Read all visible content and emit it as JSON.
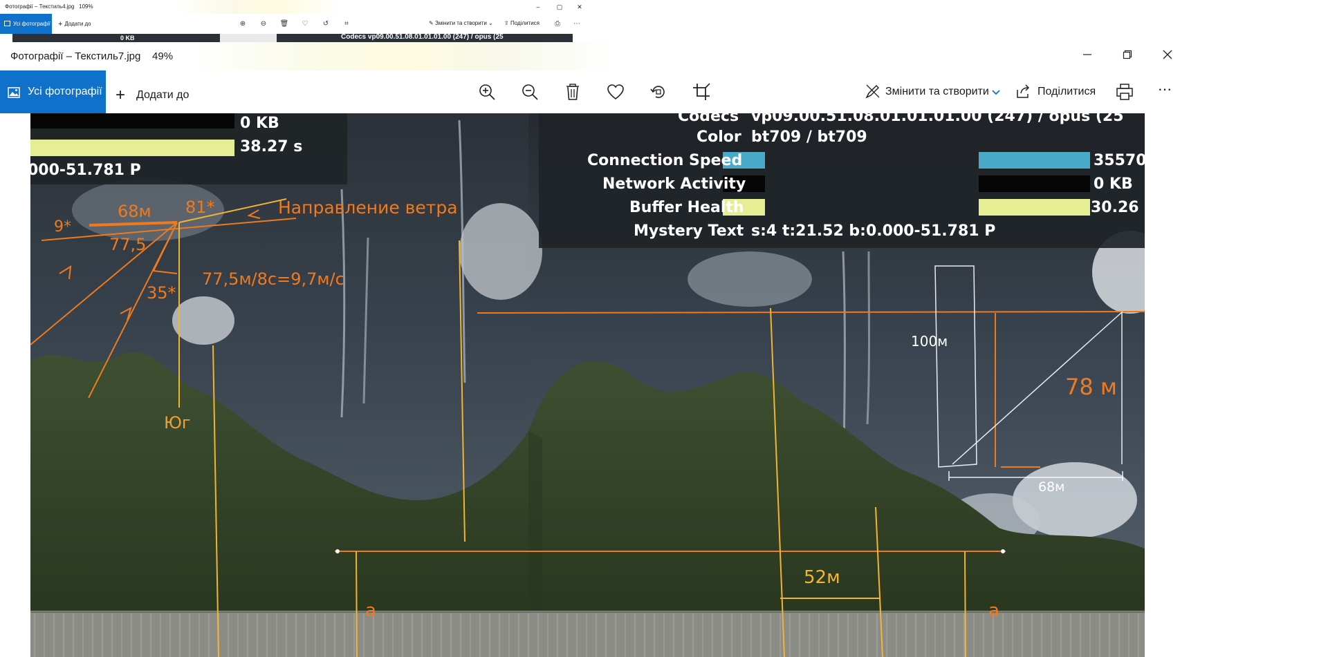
{
  "back_window": {
    "title": "Фотографії – Текстиль4.jpg",
    "zoom": "109%",
    "all_photos_label": "Усі фотографії",
    "add_to_label": "Додати до",
    "edit_create_label": "Змінити та створити",
    "share_label": "Поділитися",
    "strip_kb": "0 KB",
    "strip_codecs": "Codecs  vp09.00.51.08.01.01.01.00 (247) / opus (25"
  },
  "main_window": {
    "title": "Фотографії – Текстиль7.jpg",
    "zoom": "49%",
    "all_photos_label": "Усі фотографії",
    "add_to_label": "Додати до",
    "edit_create_label": "Змінити та створити",
    "share_label": "Поділитися",
    "icons": [
      "zoom-in-icon",
      "zoom-out-icon",
      "delete-icon",
      "favorite-icon",
      "rotate-icon",
      "crop-icon",
      "edit-icon",
      "share-icon",
      "print-icon",
      "more-icon"
    ]
  },
  "photo": {
    "left_stats": {
      "network_kb": "0 KB",
      "buffer_s": "38.27 s",
      "mystery_tail": "000-51.781 P"
    },
    "right_stats": {
      "codecs_label": "Codecs",
      "codecs_value": "vp09.00.51.08.01.01.01.00 (247) / opus (25",
      "color_label": "Color",
      "color_value": "bt709 / bt709",
      "connection_label": "Connection Speed",
      "connection_value": "35570",
      "network_label": "Network Activity",
      "network_value": "0 KB",
      "buffer_label": "Buffer Health",
      "buffer_value": "30.26",
      "mystery_label": "Mystery Text",
      "mystery_value": "s:4 t:21.52 b:0.000-51.781 P"
    },
    "annotations": {
      "angle_9": "9*",
      "dist_68": "68м",
      "angle_81": "81*",
      "wind_direction": "Направление ветра",
      "dist_77": "77,5",
      "speed_calc": "77,5м/8с=9,7м/с",
      "angle_35": "35*",
      "south": "Юг",
      "height_100": "100м",
      "height_78": "78 м",
      "base_68": "68м",
      "width_52": "52м",
      "mark_a_left": "a",
      "mark_a_right": "a"
    },
    "colors": {
      "annotation_orange": "#f07a1c",
      "annotation_yellow": "#f2b532",
      "stat_blue": "#4aa9c7",
      "stat_yellow": "#e6ee95",
      "accent_blue": "#0f71c9"
    }
  }
}
